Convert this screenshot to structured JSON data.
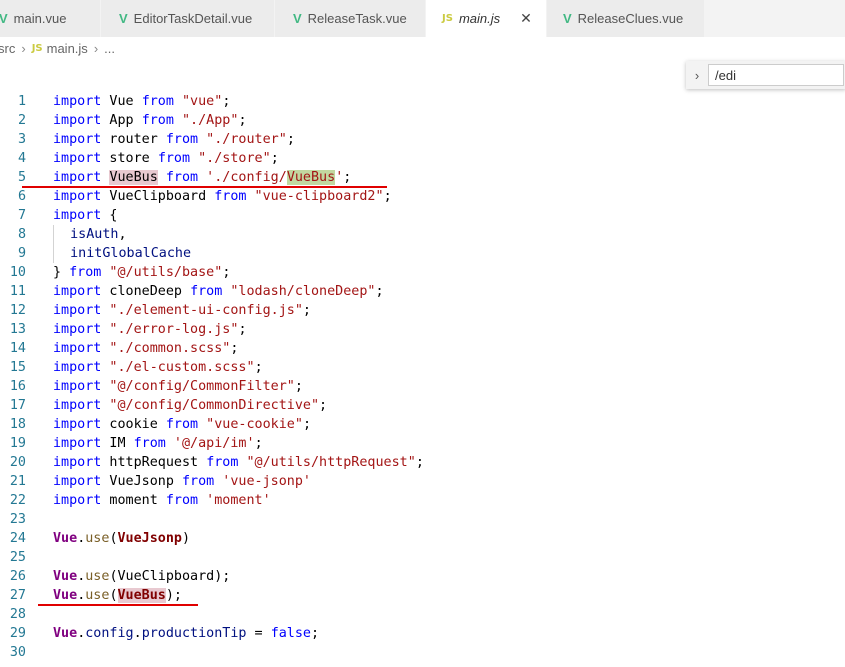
{
  "tabs": [
    {
      "label": "main.vue",
      "icon": "vue-file-icon",
      "active": false
    },
    {
      "label": "EditorTaskDetail.vue",
      "icon": "vue-file-icon",
      "active": false
    },
    {
      "label": "ReleaseTask.vue",
      "icon": "vue-file-icon",
      "active": false
    },
    {
      "label": "main.js",
      "icon": "js-file-icon",
      "active": true
    },
    {
      "label": "ReleaseClues.vue",
      "icon": "vue-file-icon",
      "active": false
    }
  ],
  "breadcrumb": {
    "folder": "src",
    "file": "main.js",
    "more": "..."
  },
  "find": {
    "value": "/edi"
  },
  "icons": {
    "vue_glyph": "V",
    "js_glyph": "JS",
    "close_glyph": "✕",
    "chevron_glyph": "›"
  },
  "lines": [
    {
      "n": "1"
    },
    {
      "n": "2"
    },
    {
      "n": "3"
    },
    {
      "n": "4"
    },
    {
      "n": "5"
    },
    {
      "n": "6"
    },
    {
      "n": "7"
    },
    {
      "n": "8"
    },
    {
      "n": "9"
    },
    {
      "n": "10"
    },
    {
      "n": "11"
    },
    {
      "n": "12"
    },
    {
      "n": "13"
    },
    {
      "n": "14"
    },
    {
      "n": "15"
    },
    {
      "n": "16"
    },
    {
      "n": "17"
    },
    {
      "n": "18"
    },
    {
      "n": "19"
    },
    {
      "n": "20"
    },
    {
      "n": "21"
    },
    {
      "n": "22"
    },
    {
      "n": "23"
    },
    {
      "n": "24"
    },
    {
      "n": "25"
    },
    {
      "n": "26"
    },
    {
      "n": "27"
    },
    {
      "n": "28"
    },
    {
      "n": "29"
    },
    {
      "n": "30"
    }
  ],
  "code": {
    "l1": [
      "import",
      " Vue ",
      "from",
      " \"vue\"",
      ";"
    ],
    "l2": [
      "import",
      " App ",
      "from",
      " \"./App\"",
      ";"
    ],
    "l3": [
      "import",
      " router ",
      "from",
      " \"./router\"",
      ";"
    ],
    "l4": [
      "import",
      " store ",
      "from",
      " \"./store\"",
      ";"
    ],
    "l5": [
      "import",
      " ",
      "VueBus",
      " ",
      "from",
      " './config/",
      "VueBus",
      "'",
      ";"
    ],
    "l6": [
      "import",
      " VueClipboard ",
      "from",
      " \"vue-clipboard2\"",
      ";"
    ],
    "l7": [
      "import",
      " {"
    ],
    "l8": [
      "isAuth",
      ","
    ],
    "l9": [
      "initGlobalCache"
    ],
    "l10": [
      "} ",
      "from",
      " \"@/utils/base\"",
      ";"
    ],
    "l11": [
      "import",
      " cloneDeep ",
      "from",
      " \"lodash/cloneDeep\"",
      ";"
    ],
    "l12": [
      "import",
      " \"./element-ui-config.js\"",
      ";"
    ],
    "l13": [
      "import",
      " \"./error-log.js\"",
      ";"
    ],
    "l14": [
      "import",
      " \"./common.scss\"",
      ";"
    ],
    "l15": [
      "import",
      " \"./el-custom.scss\"",
      ";"
    ],
    "l16": [
      "import",
      " \"@/config/CommonFilter\"",
      ";"
    ],
    "l17": [
      "import",
      " \"@/config/CommonDirective\"",
      ";"
    ],
    "l18": [
      "import",
      " cookie ",
      "from",
      " \"vue-cookie\"",
      ";"
    ],
    "l19": [
      "import",
      " IM ",
      "from",
      " '@/api/im'",
      ";"
    ],
    "l20": [
      "import",
      " httpRequest ",
      "from",
      " \"@/utils/httpRequest\"",
      ";"
    ],
    "l21": [
      "import",
      " VueJsonp ",
      "from",
      " 'vue-jsonp'"
    ],
    "l22": [
      "import",
      " moment ",
      "from",
      " 'moment'"
    ],
    "l24": [
      "Vue",
      ".",
      "use",
      "(",
      "VueJsonp",
      ")"
    ],
    "l26": [
      "Vue",
      ".",
      "use",
      "(VueClipboard);"
    ],
    "l27": [
      "Vue",
      ".",
      "use",
      "(",
      "VueBus",
      ");"
    ],
    "l29": [
      "Vue",
      ".",
      "config",
      ".",
      "productionTip",
      " = ",
      "false",
      ";"
    ]
  },
  "colors": {
    "keyword": "#0000ff",
    "string": "#a31515",
    "line_number": "#237893",
    "vue_class": "#800080",
    "function": "#795e26",
    "annotation_red": "#e00000"
  }
}
